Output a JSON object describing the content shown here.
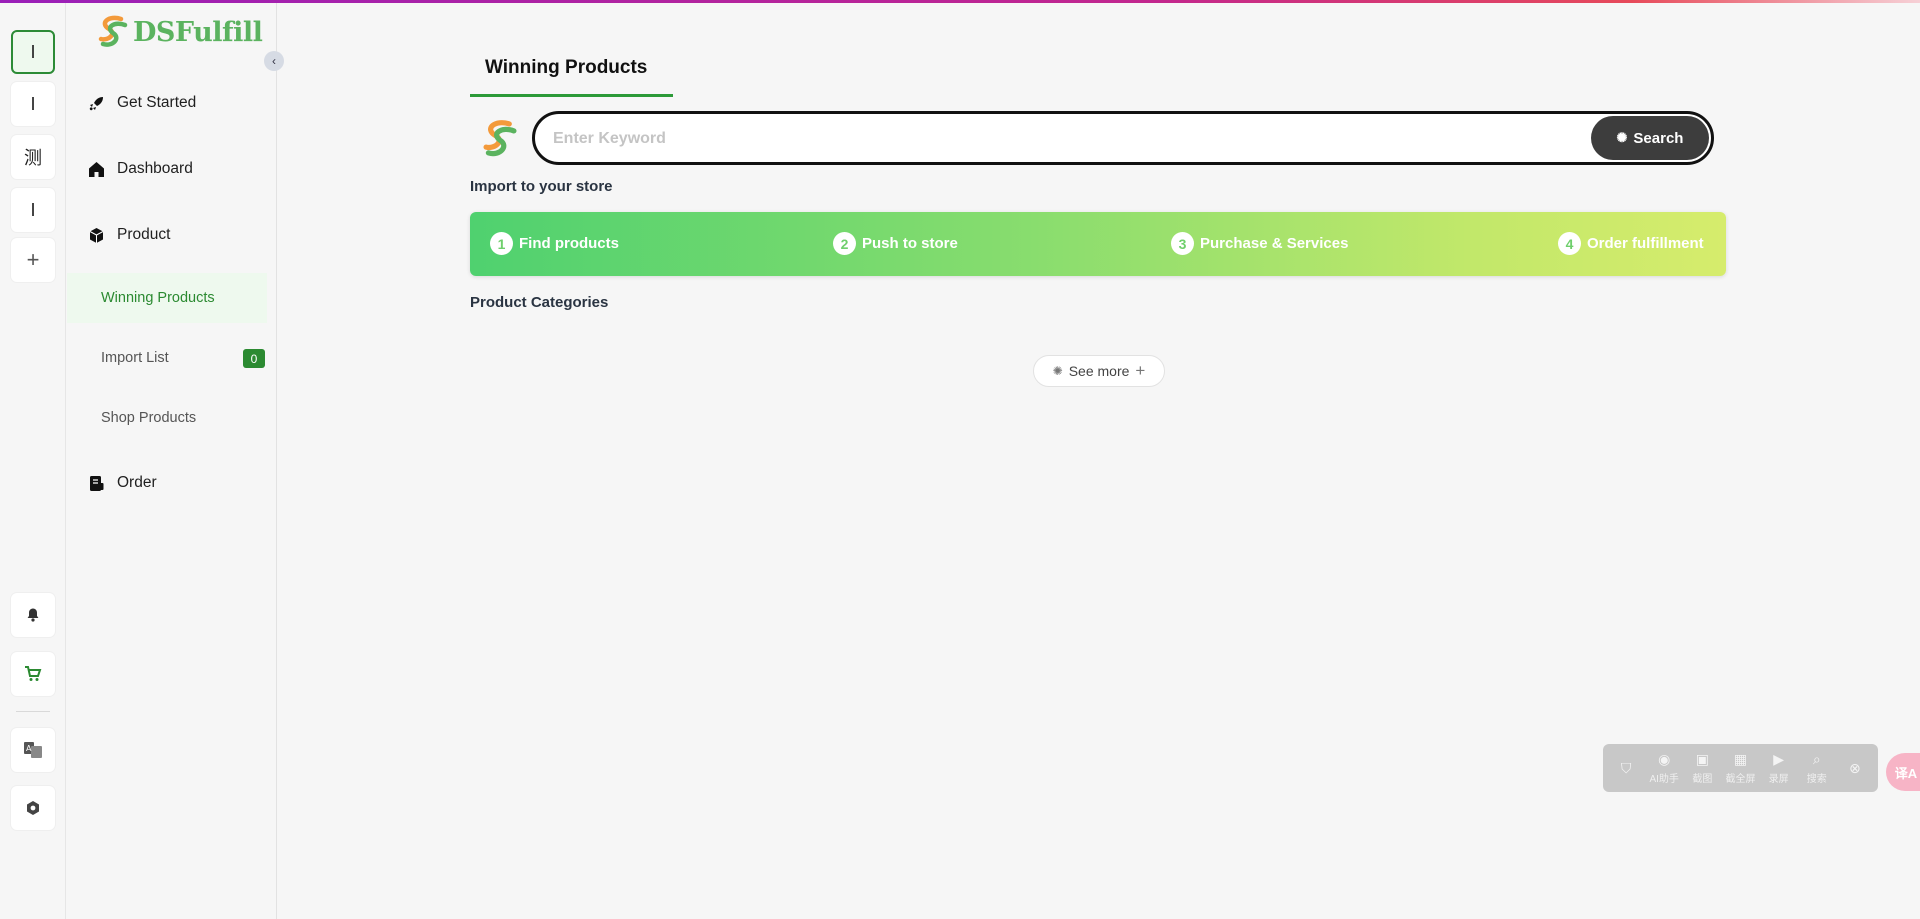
{
  "brand": {
    "name": "DSFulfill",
    "accent": "#5bb35f",
    "orange": "#f39a3b"
  },
  "rail": {
    "items": [
      {
        "label": "I",
        "active": true
      },
      {
        "label": "I",
        "active": false
      },
      {
        "label": "测",
        "active": false
      },
      {
        "label": "I",
        "active": false
      },
      {
        "label": "+",
        "active": false
      }
    ],
    "bottom_icons": [
      "bell-icon",
      "cart-icon",
      "translate-icon",
      "settings-icon"
    ]
  },
  "sidebar": {
    "get_started": "Get Started",
    "dashboard": "Dashboard",
    "product": "Product",
    "sub": {
      "winning": "Winning Products",
      "import_list": "Import List",
      "import_count": "0",
      "shop_products": "Shop Products"
    },
    "order": "Order"
  },
  "main": {
    "title": "Winning Products",
    "search": {
      "placeholder": "Enter Keyword",
      "button": "Search"
    },
    "import_label": "Import to your store",
    "steps": [
      {
        "num": "1",
        "label": "Find products"
      },
      {
        "num": "2",
        "label": "Push to store"
      },
      {
        "num": "3",
        "label": "Purchase & Services"
      },
      {
        "num": "4",
        "label": "Order fulfillment"
      }
    ],
    "categories_label": "Product Categories",
    "see_more": "See more"
  },
  "float_toolbar": {
    "items": [
      {
        "icon": "shield-icon",
        "label": ""
      },
      {
        "icon": "ai-icon",
        "label": "AI助手"
      },
      {
        "icon": "camera-icon",
        "label": "截图"
      },
      {
        "icon": "screen-icon",
        "label": "截全屏"
      },
      {
        "icon": "video-icon",
        "label": "录屏"
      },
      {
        "icon": "search-image-icon",
        "label": "搜索"
      },
      {
        "icon": "close-icon",
        "label": ""
      }
    ],
    "translate": "译A"
  }
}
